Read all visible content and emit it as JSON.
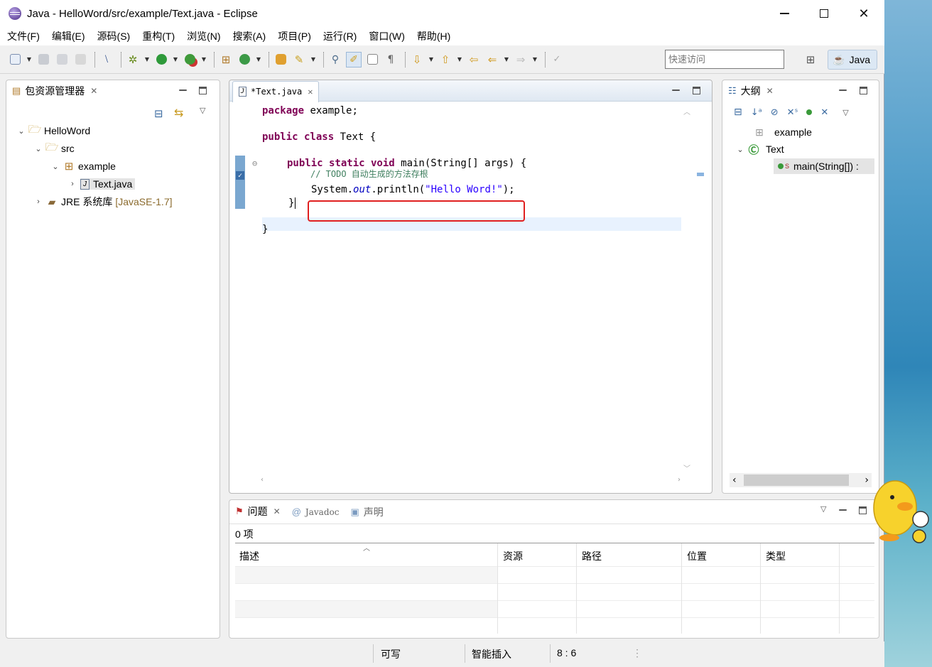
{
  "window": {
    "title": "Java  -  HelloWord/src/example/Text.java  -  Eclipse"
  },
  "menu": [
    "文件(F)",
    "编辑(E)",
    "源码(S)",
    "重构(T)",
    "浏览(N)",
    "搜索(A)",
    "项目(P)",
    "运行(R)",
    "窗口(W)",
    "帮助(H)"
  ],
  "toolbar": {
    "quick_access_placeholder": "快速访问",
    "perspective_label": "Java"
  },
  "package_explorer": {
    "tab_label": "包资源管理器",
    "tree": {
      "project": "HelloWord",
      "src": "src",
      "package": "example",
      "file": "Text.java",
      "jre": "JRE 系统库",
      "jre_version": "[JavaSE-1.7]"
    }
  },
  "editor": {
    "tab_label": "*Text.java",
    "code": {
      "l1_kw": "package",
      "l1_rest": " example;",
      "l2_kw": "public class",
      "l2_rest": " Text {",
      "l3_kw": "public static void",
      "l3_rest": " main(String[] args) {",
      "l4_comment": "// TODO 自动生成的方法存根",
      "l5_a": "System.",
      "l5_field": "out",
      "l5_b": ".println(",
      "l5_str": "\"Hello Word!\"",
      "l5_c": ");",
      "l6": "}",
      "l7": "}"
    }
  },
  "outline": {
    "tab_label": "大纲",
    "items": {
      "package": "example",
      "class": "Text",
      "method": "main(String[]) :"
    }
  },
  "problems": {
    "tabs": {
      "problems": "问题",
      "javadoc": "Javadoc",
      "declaration": "声明"
    },
    "count": "0 项",
    "columns": [
      "描述",
      "资源",
      "路径",
      "位置",
      "类型"
    ]
  },
  "status": {
    "writable": "可写",
    "insert_mode": "智能插入",
    "position": "8 : 6"
  },
  "colors": {
    "keyword": "#7f0055",
    "string": "#2a00ff",
    "field": "#0000c0",
    "comment": "#3f7f5f",
    "highlight_box": "#e02020"
  }
}
